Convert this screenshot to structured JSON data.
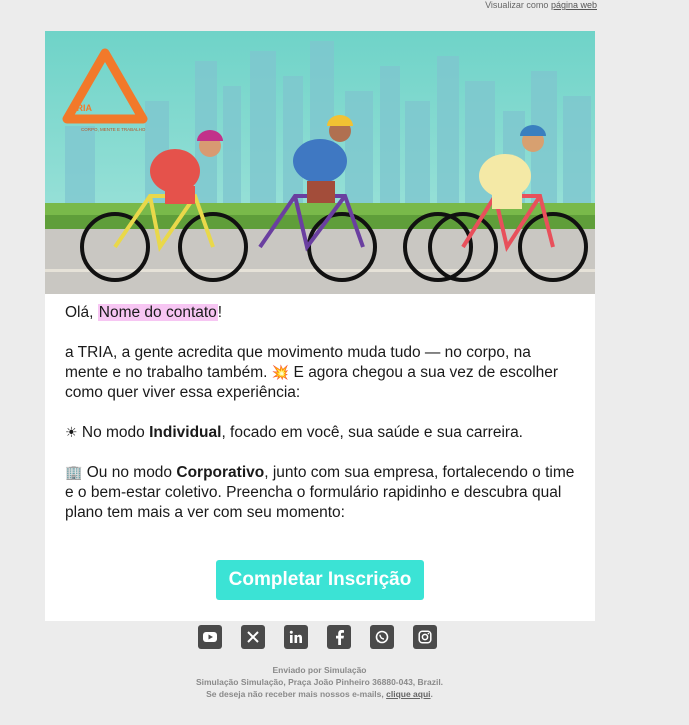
{
  "topbar": {
    "prefix": "Visualizar como",
    "link": "página web"
  },
  "brand": {
    "name": "TRIA",
    "tagline": "CORPO, MENTE E TRABALHO"
  },
  "greeting": {
    "hello": "Olá,",
    "contact": "Nome do contato",
    "bang": "!"
  },
  "paragraphs": {
    "p1_a": "a TRIA, a gente acredita que movimento muda tudo — no corpo, na mente e no trabalho também.",
    "p1_emoji": "💥",
    "p1_b": "E agora chegou a sua vez de escolher como quer viver essa experiência:",
    "p2_emoji": "☀",
    "p2_a": "No modo",
    "p2_bold": "Individual",
    "p2_b": ", focado em você, sua saúde e sua carreira.",
    "p3_emoji": "🏢",
    "p3_a": "Ou no modo",
    "p3_bold": "Corporativo",
    "p3_b": ", junto com sua empresa, fortalecendo o time e o bem-estar coletivo. Preencha o formulário rapidinho e descubra qual plano tem mais a ver com seu momento:"
  },
  "cta": {
    "label": "Completar Inscrição",
    "color": "#3be3d5"
  },
  "social": [
    "youtube-icon",
    "x-icon",
    "linkedin-icon",
    "facebook-icon",
    "whatsapp-icon",
    "instagram-icon"
  ],
  "footer": {
    "line1": "Enviado por Simulação",
    "line2": "Simulação Simulação, Praça João Pinheiro 36880-043, Brazil.",
    "line3_prefix": "Se deseja não receber mais nossos e-mails,",
    "line3_link": "clique aqui",
    "line3_suffix": "."
  },
  "colors": {
    "highlight": "#f7c6f3",
    "background": "#ececec",
    "card": "#ffffff"
  }
}
